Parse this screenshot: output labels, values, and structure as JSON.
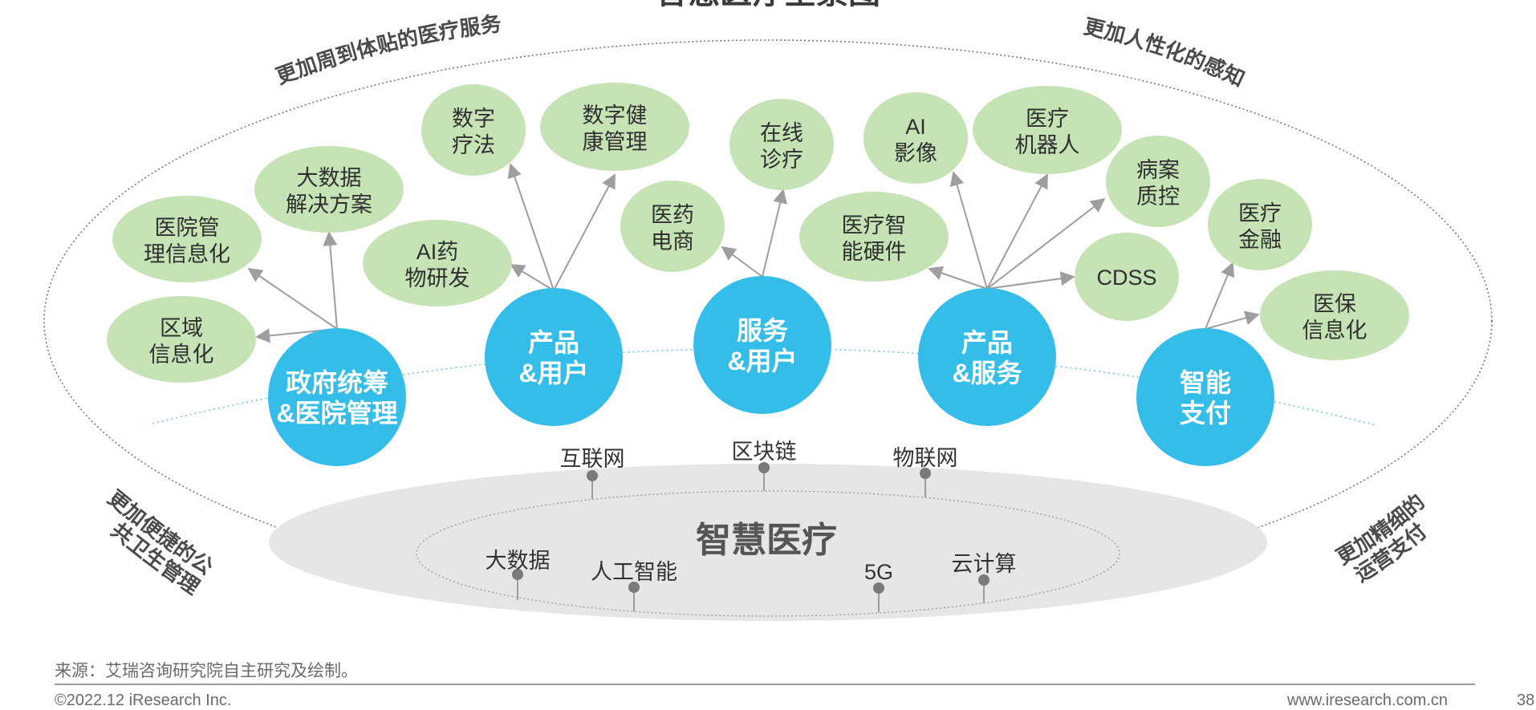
{
  "title": "智慧医疗全景图",
  "slogans": [
    "更加周到体贴的医疗服务",
    "更加人性化的感知",
    "更加便捷的公共卫生管理",
    "更加精细的运营支付"
  ],
  "hubs": [
    {
      "lines": [
        "政府统筹",
        "&医院管理"
      ]
    },
    {
      "lines": [
        "产品",
        "&用户"
      ]
    },
    {
      "lines": [
        "服务",
        "&用户"
      ]
    },
    {
      "lines": [
        "产品",
        "&服务"
      ]
    },
    {
      "lines": [
        "智能",
        "支付"
      ]
    }
  ],
  "nodes": [
    {
      "lines": [
        "区域",
        "信息化"
      ]
    },
    {
      "lines": [
        "医院管",
        "理信息化"
      ]
    },
    {
      "lines": [
        "大数据",
        "解决方案"
      ]
    },
    {
      "lines": [
        "AI药",
        "物研发"
      ]
    },
    {
      "lines": [
        "数字",
        "疗法"
      ]
    },
    {
      "lines": [
        "数字健",
        "康管理"
      ]
    },
    {
      "lines": [
        "医药",
        "电商"
      ]
    },
    {
      "lines": [
        "在线",
        "诊疗"
      ]
    },
    {
      "lines": [
        "医疗智",
        "能硬件"
      ]
    },
    {
      "lines": [
        "AI",
        "影像"
      ]
    },
    {
      "lines": [
        "医疗",
        "机器人"
      ]
    },
    {
      "lines": [
        "病案",
        "质控"
      ]
    },
    {
      "lines": [
        "CDSS"
      ]
    },
    {
      "lines": [
        "医疗",
        "金融"
      ]
    },
    {
      "lines": [
        "医保",
        "信息化"
      ]
    }
  ],
  "core": "智慧医疗",
  "technologies": [
    "互联网",
    "区块链",
    "物联网",
    "大数据",
    "人工智能",
    "5G",
    "云计算"
  ],
  "colors": {
    "hub": "#35bdea",
    "node": "#c5e3b5",
    "arrow": "#9e9e9e",
    "base": "#e6e6e6"
  },
  "footer": {
    "source": "来源：艾瑞咨询研究院自主研究及绘制。",
    "copyright": "©2022.12 iResearch Inc.",
    "website": "www.iresearch.com.cn",
    "page": "38"
  }
}
